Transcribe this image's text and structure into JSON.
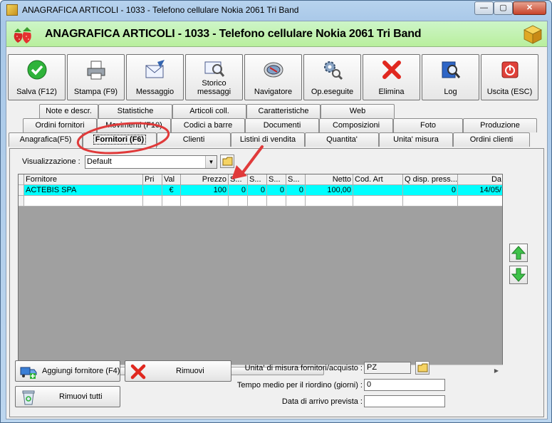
{
  "window": {
    "title": "ANAGRAFICA ARTICOLI - 1033 - Telefono cellulare Nokia 2061 Tri Band",
    "min": "—",
    "max": "▢",
    "close": "✕"
  },
  "header": {
    "title": "ANAGRAFICA ARTICOLI - 1033 - Telefono cellulare Nokia 2061 Tri Band"
  },
  "toolbar": {
    "save": "Salva (F12)",
    "print": "Stampa (F9)",
    "message": "Messaggio",
    "history_line1": "Storico",
    "history_line2": "messaggi",
    "navigator": "Navigatore",
    "operations": "Op.eseguite",
    "delete": "Elimina",
    "log": "Log",
    "exit": "Uscita (ESC)"
  },
  "tabs": {
    "row1": [
      "Note e descr.",
      "Statistiche",
      "Articoli coll.",
      "Caratteristiche",
      "Web"
    ],
    "row2": [
      "Ordini fornitori",
      "Movimenti (F10)",
      "Codici a barre",
      "Documenti",
      "Composizioni",
      "Foto",
      "Produzione"
    ],
    "row3": [
      "Anagrafica(F5)",
      "Fornitori (F6)",
      "Clienti",
      "Listini di vendita",
      "Quantita'",
      "Unita' misura",
      "Ordini clienti"
    ]
  },
  "view": {
    "label": "Visualizzazione :",
    "value": "Default"
  },
  "grid": {
    "headers": [
      "Fornitore",
      "Pri",
      "Val",
      "Prezzo",
      "S...",
      "S...",
      "S...",
      "S...",
      "Netto",
      "Cod. Art",
      "Q disp. press...",
      "Da"
    ],
    "rows": [
      [
        "ACTEBIS SPA",
        "",
        "€",
        "100",
        "0",
        "0",
        "0",
        "0",
        "100,00",
        "",
        "0",
        "14/05/"
      ]
    ],
    "scroll_grip": "III"
  },
  "buttons": {
    "add_supplier": "Aggiungi fornitore (F4)",
    "remove": "Rimuovi",
    "remove_all": "Rimuovi tutti"
  },
  "fields": {
    "unit_label": "Unita' di misura fornitori/acquisto :",
    "unit_value": "PZ",
    "reorder_label": "Tempo medio per il riordino (giorni) :",
    "reorder_value": "0",
    "arrival_label": "Data di arrivo prevista :",
    "arrival_value": ""
  },
  "colors": {
    "header_bg": "#c4f3b4",
    "selected_row": "#00ffff",
    "annotation": "#e03a3a"
  }
}
